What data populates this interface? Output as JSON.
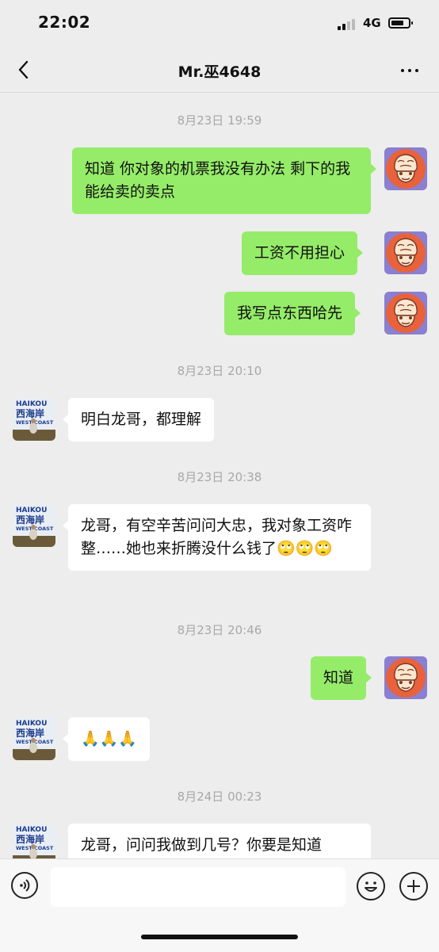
{
  "status_bar": {
    "time": "22:02",
    "network": "4G",
    "battery_level": 0.75
  },
  "header": {
    "title": "Mr.巫4648"
  },
  "messages": [
    {
      "type": "timestamp",
      "text": "8月23日 19:59"
    },
    {
      "type": "sent",
      "text": "知道  你对象的机票我没有办法 剩下的我能给卖的卖点"
    },
    {
      "type": "sent",
      "text": "工资不用担心"
    },
    {
      "type": "sent",
      "text": "我写点东西哈先"
    },
    {
      "type": "timestamp",
      "text": "8月23日 20:10"
    },
    {
      "type": "received",
      "text": "明白龙哥，都理解"
    },
    {
      "type": "timestamp",
      "text": "8月23日 20:38"
    },
    {
      "type": "received",
      "text": "龙哥，有空辛苦问问大忠，我对象工资咋整……她也来折腾没什么钱了🙄🙄🙄"
    },
    {
      "type": "timestamp",
      "text": "8月23日 20:46"
    },
    {
      "type": "sent",
      "text": "知道"
    },
    {
      "type": "received",
      "text": "🙏🙏🙏"
    },
    {
      "type": "timestamp",
      "text": "8月24日 00:23"
    },
    {
      "type": "received",
      "text": "龙哥，问问我做到几号？你要是知道"
    }
  ],
  "contact_avatar": {
    "line1": "HAIKOU",
    "line2": "西海岸",
    "line3": "WEST COAST"
  },
  "colors": {
    "sent_bubble": "#95ec69",
    "received_bubble": "#ffffff",
    "background": "#ededed",
    "my_avatar": "#e8623c"
  },
  "icons": [
    "back-arrow-icon",
    "more-icon",
    "voice-icon",
    "emoji-icon",
    "plus-icon"
  ]
}
